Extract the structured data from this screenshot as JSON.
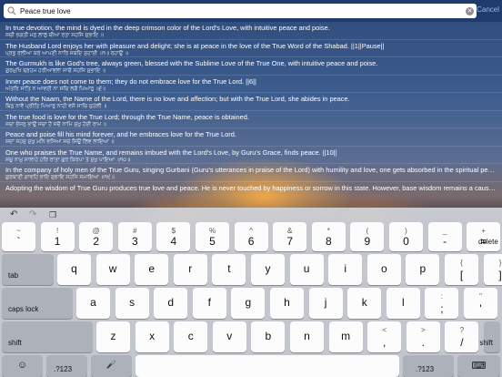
{
  "search": {
    "value": "Peace true love",
    "clear_glyph": "✕",
    "cancel_label": "Cancel"
  },
  "results": [
    {
      "en": "In true devotion, the mind is dyed in the deep crimson color of the Lord's Love, with intuitive peace and poise.",
      "gm": "ਸਚੀ ਭਗਤੀ ਮਨੁ ਲਾਲੁ ਥੀਆ ਰਤਾ ਸਹਜਿ ਸੁਭਾਇ ॥"
    },
    {
      "en": "The Husband Lord enjoys her with pleasure and delight; she is at peace in the love of the True Word of the Shabad. ||1||Pause||",
      "gm": "ਪ੍ਰਭੁ ਰਲੀਆ ਕਰੇ ਆਪਣੀ ਨਾਰਿ ਸਬਦਿ ਸੁਹਾਈ ॥੧॥ ਰਹਾਉ ॥"
    },
    {
      "en": "The Gurmukh is like God's tree, always green, blessed with the Sublime Love of the True One, with intuitive peace and poise.",
      "gm": "ਗੁਰਮੁਖਿ ਬ੍ਰਹਮ ਹਰੀਆਵਲਾ ਸਾਚੈ ਸਹਜਿ ਸੁਭਾਇ ॥"
    },
    {
      "en": "Inner peace does not come to them; they do not embrace love for the True Lord. ||6||",
      "gm": "ਅੰਤਰਿ ਸਾਂਤਿ ਨ ਆਵਈ ਨਾ ਸਚਿ ਲਗੈ ਪਿਆਰੁ ॥੬॥"
    },
    {
      "en": "Without the Naam, the Name of the Lord, there is no love and affection; but with the True Lord, she abides in peace.",
      "gm": "ਬਿਨੁ ਨਾਵੈ ਪ੍ਰੀਤਿ ਪਿਆਰੁ ਨਾਹੀ ਵਸੈ ਸਾਚਿ ਸੁਹੇਲੀ ॥"
    },
    {
      "en": "The true food is love for the True Lord; through the True Name, peace is obtained.",
      "gm": "ਸਚਾ ਭੋਜਨੁ ਭਾਉ ਸਚਾ ਹੈ ਸਚੈ ਨਾਮਿ ਸੁਖੁ ਹੋਈ ਰਾਮ ॥"
    },
    {
      "en": "Peace and poise fill his mind forever, and he embraces love for the True Lord.",
      "gm": "ਸਦਾ ਸਹਜੁ ਸੁਖੁ ਮਨਿ ਵਸਿਆ ਸਚੇ ਸਿਉ ਲਿਵ ਲਾਇਆ ॥"
    },
    {
      "en": "One who praises the True Name, and remains imbued with the Lord's Love, by Guru's Grace, finds peace. ||10||",
      "gm": "ਸਚੁ ਨਾਮੁ ਸਾਲਾਹੇ ਹਰਿ ਰਾਤਾ ਗੁਰ ਕਿਰਪਾ ਤੇ ਸੁਖੁ ਪਾਇਆ ॥੧੦॥"
    },
    {
      "en": "In the company of holy men of the True Guru, singing Gurbani (Guru's utterances in praise of the Lord) with humility and love, one gets absorbed in the spiritual peace...",
      "gm": "ਗੁਰਬਾਣੀ ਗਾਵਹਿ ਭਾਇ ਸੁਭਾਇ ਸਹਜਿ ਸਮਾਇਆ ॥੧੯॥"
    },
    {
      "en": "Adopting the wisdom of True Guru produces true love and peace. He is never touched by happiness or sorrow in this state. However, base wisdom remains a cause of ...",
      "gm": ""
    }
  ],
  "keyboard": {
    "toolbar": {
      "undo": "↶",
      "redo": "↷",
      "paste": "❐"
    },
    "row1": [
      {
        "top": "~",
        "bottom": "`"
      },
      {
        "top": "!",
        "bottom": "1"
      },
      {
        "top": "@",
        "bottom": "2"
      },
      {
        "top": "#",
        "bottom": "3"
      },
      {
        "top": "$",
        "bottom": "4"
      },
      {
        "top": "%",
        "bottom": "5"
      },
      {
        "top": "^",
        "bottom": "6"
      },
      {
        "top": "&",
        "bottom": "7"
      },
      {
        "top": "*",
        "bottom": "8"
      },
      {
        "top": "(",
        "bottom": "9"
      },
      {
        "top": ")",
        "bottom": "0"
      },
      {
        "top": "_",
        "bottom": "-"
      },
      {
        "top": "+",
        "bottom": "="
      }
    ],
    "delete_label": "delete",
    "tab_label": "tab",
    "row2": [
      "q",
      "w",
      "e",
      "r",
      "t",
      "y",
      "u",
      "i",
      "o",
      "p"
    ],
    "row2_sym": [
      {
        "top": "{",
        "bottom": "["
      },
      {
        "top": "}",
        "bottom": "]"
      },
      {
        "top": "|",
        "bottom": "\\"
      }
    ],
    "caps_label": "caps lock",
    "row3": [
      "a",
      "s",
      "d",
      "f",
      "g",
      "h",
      "j",
      "k",
      "l"
    ],
    "row3_sym": [
      {
        "top": ":",
        "bottom": ";"
      },
      {
        "top": "\"",
        "bottom": "'"
      }
    ],
    "search_label": "Search",
    "shift_label": "shift",
    "row4": [
      "z",
      "x",
      "c",
      "v",
      "b",
      "n",
      "m"
    ],
    "row4_sym": [
      {
        "top": "<",
        "bottom": ","
      },
      {
        "top": ">",
        "bottom": "."
      },
      {
        "top": "?",
        "bottom": "/"
      }
    ],
    "emoji_glyph": "☺",
    "numbers_label": ".?123",
    "mic_glyph": "🎤",
    "hide_glyph": "⌨"
  }
}
